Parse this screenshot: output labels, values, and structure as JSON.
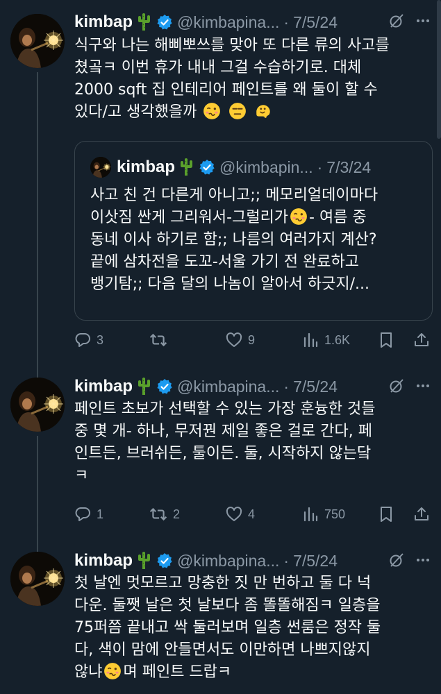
{
  "tweets": [
    {
      "name": "kimbap",
      "handle": "@kimbapina...",
      "dot": "·",
      "date": "7/5/24",
      "lines": [
        "식구와 나는 해삐뽀쓰를 맞아 또 다른 류의 사고를",
        "쳤곸ㅋ 이번 휴가 내내 그걸 수습하기로. 대체",
        "2000 sqft 집 인테리어 페인트를 왜 둘이 할 수",
        "있다/고 생각했을까"
      ],
      "quote": {
        "name": "kimbap",
        "handle": "@kimbapin...",
        "dot": "·",
        "date": "7/3/24",
        "lines": [
          "사고 친 건 다른게 아니고;; 메모리얼데이마다",
          "이삿짐 싼게 그리워서-그럴리가",
          "동네 이사 하기로 함;; 나름의 여러가지 계산?",
          "끝에 삼차전을 도꼬-서울 가기 전 완료하고",
          "뱅기탐;; 다음 달의 나놈이 알아서 하긋지/..."
        ],
        "line2_tail": "- 여름 중"
      },
      "stats": {
        "replies": "3",
        "retweets": "",
        "likes": "9",
        "views": "1.6K"
      }
    },
    {
      "name": "kimbap",
      "handle": "@kimbapina...",
      "dot": "·",
      "date": "7/5/24",
      "lines": [
        "페인트 초보가 선택할 수 있는 가장 훈늉한 것들",
        "중 몇 개- 하나, 무저꿘 제일 좋은 걸로 간다, 페",
        "인트든, 브러쉬든, 툴이든. 둘, 시작하지 않는닼",
        "ㅋ"
      ],
      "stats": {
        "replies": "1",
        "retweets": "2",
        "likes": "4",
        "views": "750"
      }
    },
    {
      "name": "kimbap",
      "handle": "@kimbapina...",
      "dot": "·",
      "date": "7/5/24",
      "lines": [
        "첫 날엔 멋모르고 망충한 짓 만 번하고 둘 다 넉",
        "다운. 둘쨋 날은 첫 날보다 좀 똘똘해짐ㅋ 일층을",
        "75퍼쯤 끝내고 싹 둘러보며 일층 썬룸은 정작 둘",
        "다, 색이 맘에 안들면서도 이만하면 나쁘지않지",
        "않냐"
      ],
      "line5_tail": "며 페인트 드랍ㅋ"
    }
  ],
  "colors": {
    "background": "#15202b",
    "text": "#f7f9f9",
    "muted": "#8b98a5",
    "verified": "#1d9bf0",
    "border": "#38444d"
  },
  "icons": [
    "cactus-emoji",
    "verified-badge-icon",
    "grok-icon",
    "more-icon",
    "reply-icon",
    "retweet-icon",
    "like-icon",
    "views-icon",
    "bookmark-icon",
    "share-icon",
    "woozy-face-emoji",
    "expressionless-face-emoji",
    "melting-face-emoji"
  ]
}
